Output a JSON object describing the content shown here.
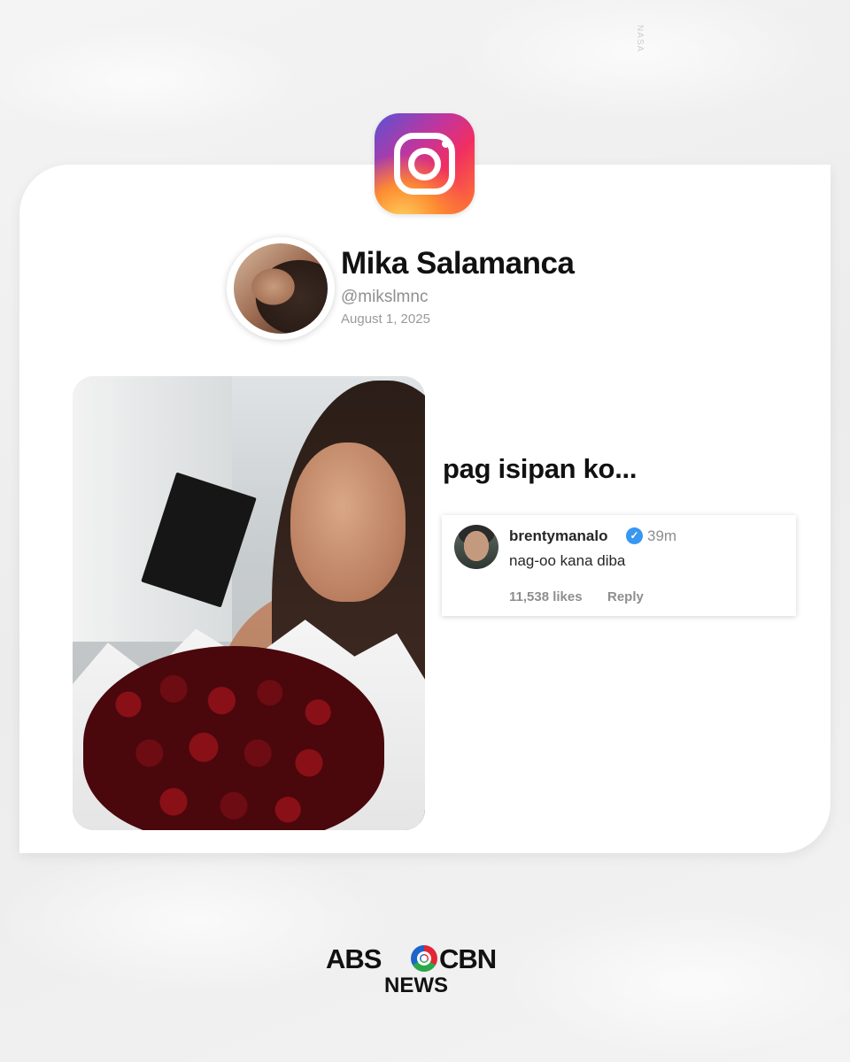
{
  "watermark": "NASA",
  "post": {
    "platform_icon": "instagram-icon",
    "name": "Mika Salamanca",
    "handle": "@mikslmnc",
    "date": "August 1, 2025",
    "caption": "pag isipan ko..."
  },
  "comment": {
    "username": "brentymanalo",
    "verified_icon": "verified-badge-icon",
    "verified_glyph": "✓",
    "time": "39m",
    "text": "nag-oo kana diba",
    "likes": "11,538 likes",
    "reply_label": "Reply"
  },
  "brand": {
    "abs": "ABS",
    "cbn": "CBN",
    "news": "NEWS"
  },
  "colors": {
    "background": "#f1f1f1",
    "card": "#ffffff",
    "verified": "#3897f0",
    "muted_text": "#8e8e8e"
  }
}
